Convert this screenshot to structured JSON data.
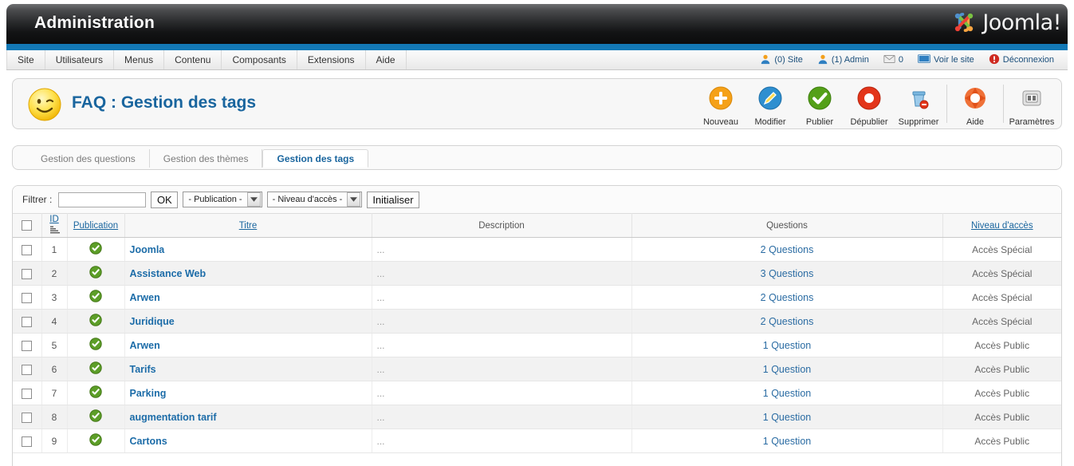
{
  "header": {
    "title": "Administration",
    "logo_text": "Joomla!",
    "logo_icon": "joomla-logo-icon"
  },
  "menubar": {
    "items": [
      {
        "label": "Site"
      },
      {
        "label": "Utilisateurs"
      },
      {
        "label": "Menus"
      },
      {
        "label": "Contenu"
      },
      {
        "label": "Composants"
      },
      {
        "label": "Extensions"
      },
      {
        "label": "Aide"
      }
    ],
    "status": {
      "site_visitors": "(0) Site",
      "admin_users": "(1) Admin",
      "messages_count": "0",
      "preview_label": "Voir le site",
      "logout_label": "Déconnexion"
    }
  },
  "page": {
    "icon": "smiley-wink-icon",
    "title": "FAQ : Gestion des tags"
  },
  "toolbar": {
    "buttons": [
      {
        "label": "Nouveau",
        "icon": "new-plus-icon"
      },
      {
        "label": "Modifier",
        "icon": "edit-pencil-icon"
      },
      {
        "label": "Publier",
        "icon": "publish-check-icon"
      },
      {
        "label": "Dépublier",
        "icon": "unpublish-circle-icon"
      },
      {
        "label": "Supprimer",
        "icon": "delete-trash-icon"
      },
      {
        "label": "Aide",
        "icon": "help-lifering-icon"
      },
      {
        "label": "Paramètres",
        "icon": "options-gear-icon"
      }
    ]
  },
  "tabs": [
    {
      "label": "Gestion des questions",
      "active": false
    },
    {
      "label": "Gestion des thèmes",
      "active": false
    },
    {
      "label": "Gestion des tags",
      "active": true
    }
  ],
  "filter": {
    "label": "Filtrer :",
    "search_value": "",
    "search_placeholder": "",
    "ok_label": "OK",
    "publication_select": "- Publication -",
    "access_select": "- Niveau d'accès -",
    "reset_label": "Initialiser"
  },
  "table": {
    "columns": [
      {
        "key": "check",
        "label": "",
        "sortable": false
      },
      {
        "key": "id",
        "label": "ID",
        "sortable": true
      },
      {
        "key": "publication",
        "label": "Publication",
        "sortable": true
      },
      {
        "key": "title",
        "label": "Titre",
        "sortable": true
      },
      {
        "key": "description",
        "label": "Description",
        "sortable": false
      },
      {
        "key": "questions",
        "label": "Questions",
        "sortable": false
      },
      {
        "key": "access",
        "label": "Niveau d'accès",
        "sortable": true
      }
    ],
    "sort_column": "ID",
    "sort_direction": "descending",
    "rows": [
      {
        "id": "1",
        "published": true,
        "title": "Joomla",
        "description": "...",
        "questions": "2 Questions",
        "access": "Accès Spécial"
      },
      {
        "id": "2",
        "published": true,
        "title": "Assistance Web",
        "description": "...",
        "questions": "3 Questions",
        "access": "Accès Spécial"
      },
      {
        "id": "3",
        "published": true,
        "title": "Arwen",
        "description": "...",
        "questions": "2 Questions",
        "access": "Accès Spécial"
      },
      {
        "id": "4",
        "published": true,
        "title": "Juridique",
        "description": "...",
        "questions": "2 Questions",
        "access": "Accès Spécial"
      },
      {
        "id": "5",
        "published": true,
        "title": "Arwen",
        "description": "...",
        "questions": "1 Question",
        "access": "Accès Public"
      },
      {
        "id": "6",
        "published": true,
        "title": "Tarifs",
        "description": "...",
        "questions": "1 Question",
        "access": "Accès Public"
      },
      {
        "id": "7",
        "published": true,
        "title": "Parking",
        "description": "...",
        "questions": "1 Question",
        "access": "Accès Public"
      },
      {
        "id": "8",
        "published": true,
        "title": "augmentation tarif",
        "description": "...",
        "questions": "1 Question",
        "access": "Accès Public"
      },
      {
        "id": "9",
        "published": true,
        "title": "Cartons",
        "description": "...",
        "questions": "1 Question",
        "access": "Accès Public"
      }
    ]
  },
  "colors": {
    "header_blue_bar": "#1378b5",
    "link_blue": "#19659e",
    "publish_green": "#5c9e27",
    "accent_orange": "#f5a118",
    "unpublish_red": "#e03b1c"
  }
}
